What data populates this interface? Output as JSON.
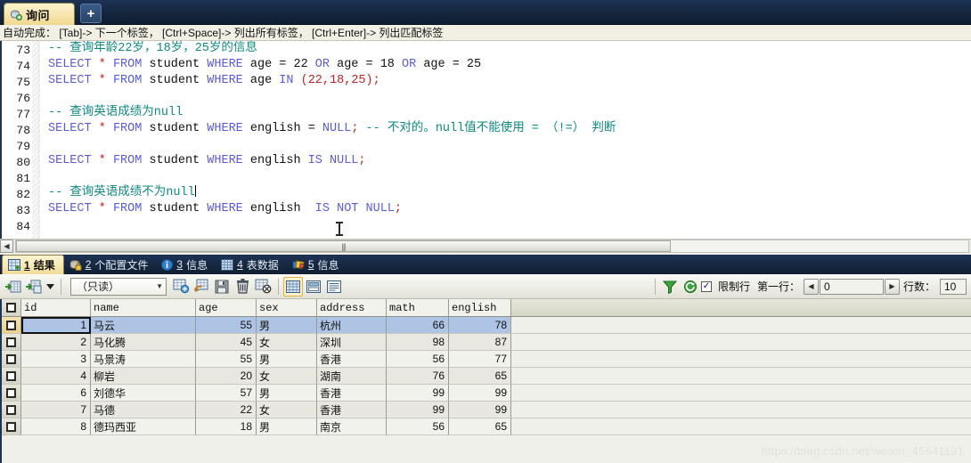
{
  "window": {
    "tab_label": "询问",
    "new_tab_label": "+",
    "tab_icon": "query-icon"
  },
  "hint_bar": {
    "text": "自动完成： [Tab]-> 下一个标签， [Ctrl+Space]-> 列出所有标签， [Ctrl+Enter]-> 列出匹配标签"
  },
  "editor": {
    "first_line": 73,
    "lines": [
      {
        "n": 73,
        "tokens": [
          {
            "t": "-- 查询年龄22岁，18岁，25岁的信息",
            "c": "cmt"
          }
        ]
      },
      {
        "n": 74,
        "tokens": [
          {
            "t": "SELECT",
            "c": "kw"
          },
          {
            "t": " ",
            "c": "plain"
          },
          {
            "t": "*",
            "c": "punc"
          },
          {
            "t": " ",
            "c": "plain"
          },
          {
            "t": "FROM",
            "c": "kw"
          },
          {
            "t": " student ",
            "c": "plain"
          },
          {
            "t": "WHERE",
            "c": "kw"
          },
          {
            "t": " age = 22 ",
            "c": "plain"
          },
          {
            "t": "OR",
            "c": "kw"
          },
          {
            "t": " age = 18 ",
            "c": "plain"
          },
          {
            "t": "OR",
            "c": "kw"
          },
          {
            "t": " age = 25",
            "c": "plain"
          }
        ]
      },
      {
        "n": 75,
        "tokens": [
          {
            "t": "SELECT",
            "c": "kw"
          },
          {
            "t": " ",
            "c": "plain"
          },
          {
            "t": "*",
            "c": "punc"
          },
          {
            "t": " ",
            "c": "plain"
          },
          {
            "t": "FROM",
            "c": "kw"
          },
          {
            "t": " student ",
            "c": "plain"
          },
          {
            "t": "WHERE",
            "c": "kw"
          },
          {
            "t": " age ",
            "c": "plain"
          },
          {
            "t": "IN",
            "c": "kw"
          },
          {
            "t": " ",
            "c": "plain"
          },
          {
            "t": "(22,18,25);",
            "c": "punc"
          }
        ]
      },
      {
        "n": 76,
        "tokens": []
      },
      {
        "n": 77,
        "tokens": [
          {
            "t": "-- 查询英语成绩为null",
            "c": "cmt"
          }
        ]
      },
      {
        "n": 78,
        "tokens": [
          {
            "t": "SELECT",
            "c": "kw"
          },
          {
            "t": " ",
            "c": "plain"
          },
          {
            "t": "*",
            "c": "punc"
          },
          {
            "t": " ",
            "c": "plain"
          },
          {
            "t": "FROM",
            "c": "kw"
          },
          {
            "t": " student ",
            "c": "plain"
          },
          {
            "t": "WHERE",
            "c": "kw"
          },
          {
            "t": " english = ",
            "c": "plain"
          },
          {
            "t": "NULL",
            "c": "kw"
          },
          {
            "t": ";",
            "c": "punc"
          },
          {
            "t": " -- 不对的。null值不能使用 = （!=） 判断",
            "c": "cmt"
          }
        ]
      },
      {
        "n": 79,
        "tokens": []
      },
      {
        "n": 80,
        "tokens": [
          {
            "t": "SELECT",
            "c": "kw"
          },
          {
            "t": " ",
            "c": "plain"
          },
          {
            "t": "*",
            "c": "punc"
          },
          {
            "t": " ",
            "c": "plain"
          },
          {
            "t": "FROM",
            "c": "kw"
          },
          {
            "t": " student ",
            "c": "plain"
          },
          {
            "t": "WHERE",
            "c": "kw"
          },
          {
            "t": " english ",
            "c": "plain"
          },
          {
            "t": "IS NULL",
            "c": "kw"
          },
          {
            "t": ";",
            "c": "punc"
          }
        ]
      },
      {
        "n": 81,
        "tokens": []
      },
      {
        "n": 82,
        "tokens": [
          {
            "t": "-- 查询英语成绩不为null",
            "c": "cmt"
          }
        ],
        "caret": true
      },
      {
        "n": 83,
        "tokens": [
          {
            "t": "SELECT",
            "c": "kw"
          },
          {
            "t": " ",
            "c": "plain"
          },
          {
            "t": "*",
            "c": "punc"
          },
          {
            "t": " ",
            "c": "plain"
          },
          {
            "t": "FROM",
            "c": "kw"
          },
          {
            "t": " student ",
            "c": "plain"
          },
          {
            "t": "WHERE",
            "c": "kw"
          },
          {
            "t": " english  ",
            "c": "plain"
          },
          {
            "t": "IS NOT NULL",
            "c": "kw"
          },
          {
            "t": ";",
            "c": "punc"
          }
        ]
      },
      {
        "n": 84,
        "tokens": []
      }
    ]
  },
  "result_tabs": [
    {
      "num": "1",
      "label": "结果",
      "icon": "result-grid-icon",
      "active": true
    },
    {
      "num": "2",
      "label": "个配置文件",
      "icon": "profile-icon",
      "active": false
    },
    {
      "num": "3",
      "label": "信息",
      "icon": "info-icon",
      "active": false
    },
    {
      "num": "4",
      "label": "表数据",
      "icon": "table-data-icon",
      "active": false
    },
    {
      "num": "5",
      "label": "信息",
      "icon": "status-icon",
      "active": false
    }
  ],
  "grid_toolbar": {
    "mode_select_value": "（只读）",
    "limit_rows_label": "限制行",
    "limit_rows_checked": true,
    "first_row_label": "第一行：",
    "first_row_value": "0",
    "row_count_label": "行数：",
    "row_count_value": "10",
    "icons": [
      "import-wizard-icon",
      "export-wizard-icon",
      "dropdown-arrow-icon",
      "add-record-icon",
      "duplicate-record-icon",
      "save-record-icon",
      "delete-record-icon",
      "cancel-record-icon",
      "grid-view-icon",
      "form-view-icon",
      "text-view-icon",
      "filter-icon",
      "refresh-icon"
    ]
  },
  "table": {
    "columns": [
      "id",
      "name",
      "age",
      "sex",
      "address",
      "math",
      "english"
    ],
    "selected_column": "id",
    "selected_row_index": 0,
    "rows": [
      {
        "id": "1",
        "name": "马云",
        "age": "55",
        "sex": "男",
        "address": "杭州",
        "math": "66",
        "english": "78"
      },
      {
        "id": "2",
        "name": "马化腾",
        "age": "45",
        "sex": "女",
        "address": "深圳",
        "math": "98",
        "english": "87"
      },
      {
        "id": "3",
        "name": "马景涛",
        "age": "55",
        "sex": "男",
        "address": "香港",
        "math": "56",
        "english": "77"
      },
      {
        "id": "4",
        "name": "柳岩",
        "age": "20",
        "sex": "女",
        "address": "湖南",
        "math": "76",
        "english": "65"
      },
      {
        "id": "6",
        "name": "刘德华",
        "age": "57",
        "sex": "男",
        "address": "香港",
        "math": "99",
        "english": "99"
      },
      {
        "id": "7",
        "name": "马德",
        "age": "22",
        "sex": "女",
        "address": "香港",
        "math": "99",
        "english": "99"
      },
      {
        "id": "8",
        "name": "德玛西亚",
        "age": "18",
        "sex": "男",
        "address": "南京",
        "math": "56",
        "english": "65"
      }
    ]
  },
  "watermark": {
    "text": "https://blog.csdn.net/weixin_45641191"
  },
  "colors": {
    "titlebar": "#16273e",
    "active_tab": "#f6e4ad",
    "keyword": "#5b5be0",
    "comment": "#0e8a82",
    "literal": "#c02020",
    "row_selected": "#aec4e4",
    "header_selected": "#f5d58a"
  }
}
